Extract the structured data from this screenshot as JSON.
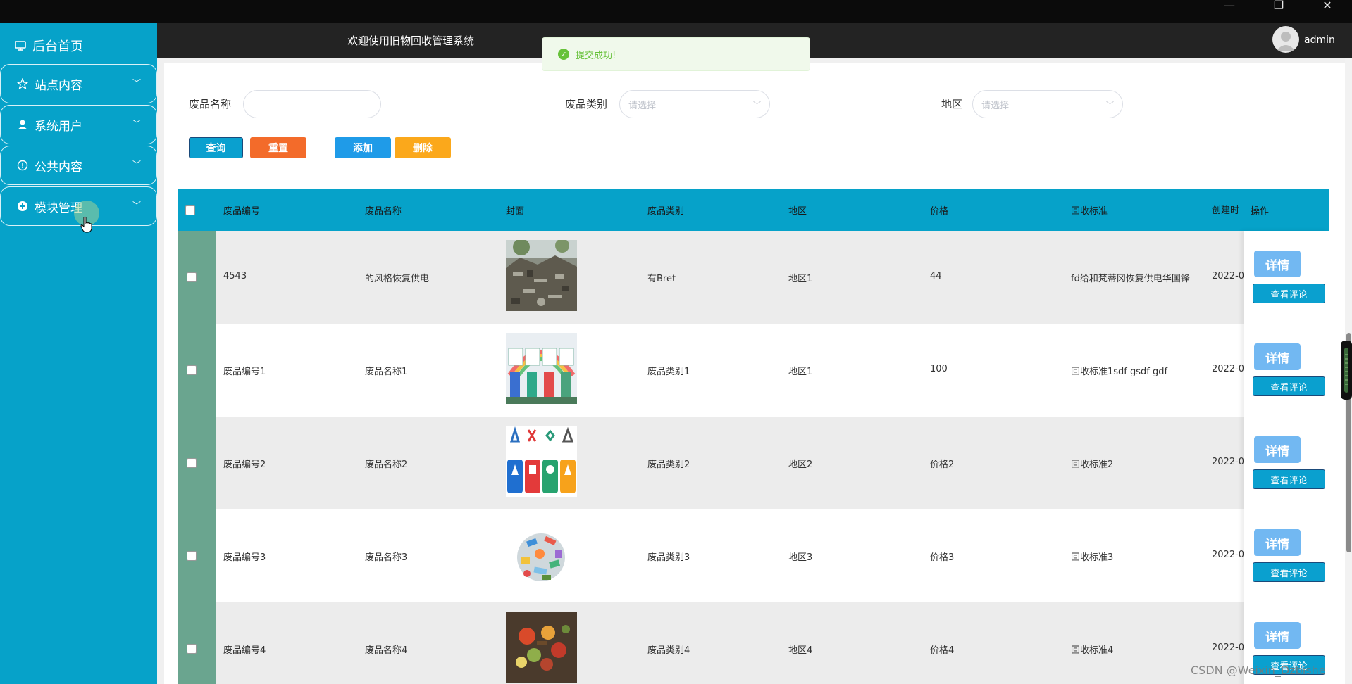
{
  "window": {
    "minimize": "—",
    "restore": "❐",
    "close": "✕"
  },
  "sidebar": {
    "home": "后台首页",
    "items": [
      {
        "label": "站点内容",
        "icon": "star-icon"
      },
      {
        "label": "系统用户",
        "icon": "user-icon"
      },
      {
        "label": "公共内容",
        "icon": "info-icon"
      },
      {
        "label": "模块管理",
        "icon": "plus-circle-icon"
      }
    ]
  },
  "header": {
    "welcome": "欢迎使用旧物回收管理系统",
    "username": "admin"
  },
  "toast": {
    "message": "提交成功!"
  },
  "search": {
    "name_label": "废品名称",
    "name_value": "",
    "category_label": "废品类别",
    "category_placeholder": "请选择",
    "region_label": "地区",
    "region_placeholder": "请选择"
  },
  "buttons": {
    "query": "查询",
    "reset": "重置",
    "add": "添加",
    "delete": "删除"
  },
  "colors": {
    "primary": "#06a2c9",
    "query": "#0aa0cf",
    "reset": "#f36b2a",
    "add": "#1f9be8",
    "delete": "#fba81b",
    "check_column": "#6aa58f"
  },
  "table": {
    "headers": [
      "废品编号",
      "废品名称",
      "封面",
      "废品类别",
      "地区",
      "价格",
      "回收标准",
      "创建时",
      "操作"
    ],
    "rows": [
      {
        "code": "4543",
        "name": "的风格恢复供电",
        "category": "有Bret",
        "region": "地区1",
        "price": "44",
        "standard": "fd给和梵蒂冈恢复供电华国锋",
        "created": "2022-0",
        "cover": "scrap-pile-image"
      },
      {
        "code": "废品编号1",
        "name": "废品名称1",
        "category": "废品类别1",
        "region": "地区1",
        "price": "100",
        "standard": "回收标准1sdf gsdf gdf",
        "created": "2022-0",
        "cover": "recycling-bins-image"
      },
      {
        "code": "废品编号2",
        "name": "废品名称2",
        "category": "废品类别2",
        "region": "地区2",
        "price": "价格2",
        "standard": "回收标准2",
        "created": "2022-0",
        "cover": "recycling-symbols-image"
      },
      {
        "code": "废品编号3",
        "name": "废品名称3",
        "category": "废品类别3",
        "region": "地区3",
        "price": "价格3",
        "standard": "回收标准3",
        "created": "2022-0",
        "cover": "trash-heap-image"
      },
      {
        "code": "废品编号4",
        "name": "废品名称4",
        "category": "废品类别4",
        "region": "地区4",
        "price": "价格4",
        "standard": "回收标准4",
        "created": "2022-0",
        "cover": "food-waste-image"
      }
    ],
    "detail_label": "详情",
    "comments_label": "查看评论"
  },
  "watermark": "CSDN @Weixin_Dzbishe"
}
